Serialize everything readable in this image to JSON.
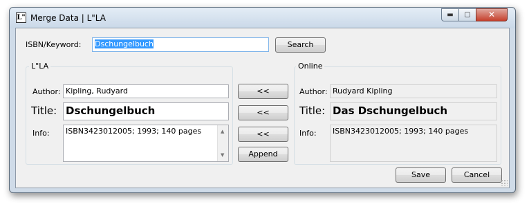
{
  "window": {
    "title": "Merge Data | L\"LA",
    "icon_glyph": "L\"",
    "controls": {
      "minimize": "▬",
      "maximize": "▢",
      "close": "✕"
    }
  },
  "search": {
    "label": "ISBN/Keyword:",
    "value": "Dschungelbuch",
    "button": "Search"
  },
  "local": {
    "group_title": "L\"LA",
    "author_label": "Author:",
    "author_value": "Kipling, Rudyard",
    "title_label": "Title:",
    "title_value": "Dschungelbuch",
    "info_label": "Info:",
    "info_value": "ISBN3423012005; 1993; 140 pages"
  },
  "online": {
    "group_title": "Online",
    "author_label": "Author:",
    "author_value": "Rudyard Kipling",
    "title_label": "Title:",
    "title_value": "Das Dschungelbuch",
    "info_label": "Info:",
    "info_value": "ISBN3423012005; 1993; 140 pages"
  },
  "copy_buttons": {
    "author": "<<",
    "title": "<<",
    "info": "<<",
    "append": "Append"
  },
  "footer": {
    "save": "Save",
    "cancel": "Cancel"
  }
}
